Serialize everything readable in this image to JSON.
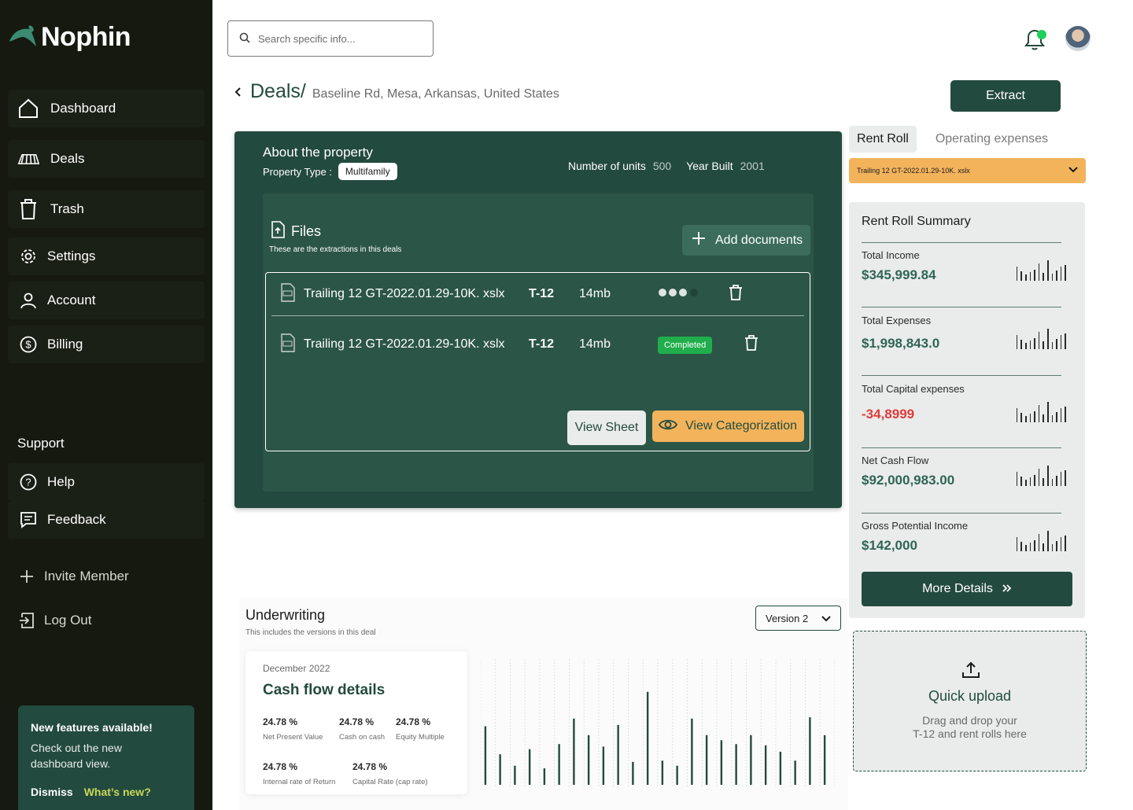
{
  "brand": {
    "name": "Nophin"
  },
  "sidebar": {
    "items": [
      {
        "label": "Dashboard",
        "icon": "home-icon"
      },
      {
        "label": "Deals",
        "icon": "deals-icon"
      },
      {
        "label": "Trash",
        "icon": "trash-icon"
      },
      {
        "label": "Settings",
        "icon": "gear-icon"
      },
      {
        "label": "Account",
        "icon": "user-icon"
      },
      {
        "label": "Billing",
        "icon": "dollar-icon"
      }
    ],
    "support_label": "Support",
    "support_items": [
      {
        "label": "Help",
        "icon": "help-icon"
      },
      {
        "label": "Feedback",
        "icon": "feedback-icon"
      }
    ],
    "invite_label": "Invite Member",
    "logout_label": "Log Out",
    "promo": {
      "title": "New features available!",
      "description": "Check out the new dashboard view.",
      "dismiss": "Dismiss",
      "whats_new": "What’s new?"
    }
  },
  "header": {
    "search_placeholder": "Search specific info...",
    "notification_color": "#1fcf5b"
  },
  "breadcrumb": {
    "section": "Deals/",
    "address": "Baseline Rd,  Mesa, Arkansas, United States"
  },
  "extract_label": "Extract",
  "property": {
    "title": "About the property",
    "type_label": "Property Type :",
    "type_value": "Multifamily",
    "units_label": "Number of units",
    "units_value": "500",
    "year_label": "Year Built",
    "year_value": "2001"
  },
  "files": {
    "title": "Files",
    "subtitle": "These are the extractions in this deals",
    "add_label": "Add documents",
    "rows": [
      {
        "name": "Trailing 12 GT-2022.01.29-10K. xslx",
        "type": "T-12",
        "size": "14mb",
        "status": "processing"
      },
      {
        "name": "Trailing 12 GT-2022.01.29-10K. xslx",
        "type": "T-12",
        "size": "14mb",
        "status": "Completed"
      }
    ],
    "view_sheet": "View Sheet",
    "view_categorization": "View Categorization"
  },
  "right": {
    "tabs": [
      "Rent Roll",
      "Operating expenses"
    ],
    "active_tab": "Rent Roll",
    "file_select": "Trailing 12 GT-2022.01.29-10K. xslx",
    "summary_title": "Rent Roll Summary",
    "summary": [
      {
        "label": "Total Income",
        "value": "$345,999.84"
      },
      {
        "label": "Total Expenses",
        "value": "$1,998,843.0"
      },
      {
        "label": "Total Capital expenses",
        "value": "-34,8999"
      },
      {
        "label": "Net Cash Flow",
        "value": "$92,000,983.00"
      },
      {
        "label": "Gross Potential Income",
        "value": "$142,000"
      }
    ],
    "more_details": "More Details",
    "quick_upload": {
      "title": "Quick upload",
      "line1": "Drag and drop your",
      "line2": "T-12 and rent rolls here"
    }
  },
  "underwriting": {
    "title": "Underwriting",
    "subtitle": "This includes the versions in this deal",
    "version": "Version 2",
    "card": {
      "date": "December 2022",
      "title": "Cash flow details",
      "metrics": [
        {
          "value": "24.78 %",
          "label": "Net Present Value"
        },
        {
          "value": "24.78 %",
          "label": "Cash on cash"
        },
        {
          "value": "24.78 %",
          "label": "Equity Multiple"
        },
        {
          "value": "24.78 %",
          "label": "Internal rate of Return"
        },
        {
          "value": "24.78 %",
          "label": "Capital Rate (cap rate)"
        }
      ]
    }
  },
  "chart_data": {
    "type": "bar",
    "values": [
      46,
      24,
      15,
      28,
      13,
      32,
      52,
      39,
      30,
      47,
      18,
      73,
      19,
      15,
      52,
      39,
      35,
      32,
      39,
      31,
      26,
      19,
      53,
      39
    ],
    "ylim": [
      0,
      100
    ],
    "color": "#234a3e",
    "grid": true
  }
}
